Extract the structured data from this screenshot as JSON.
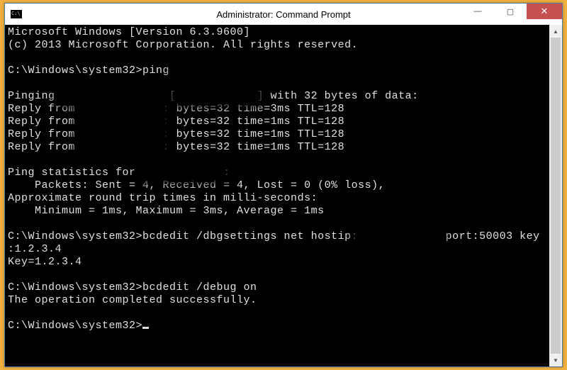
{
  "window": {
    "title": "Administrator: Command Prompt"
  },
  "controls": {
    "minimize": "—",
    "maximize": "▢",
    "close": "✕"
  },
  "terminal": {
    "lines": [
      {
        "t": "Microsoft Windows [Version 6.3.9600]"
      },
      {
        "t": "(c) 2013 Microsoft Corporation. All rights reserved."
      },
      {
        "t": ""
      },
      {
        "pre": "C:\\Windows\\system32>",
        "cmd": "ping ",
        "blur": "xxxxxxxx xx"
      },
      {
        "t": ""
      },
      {
        "pre": "Pinging ",
        "blur": "xxxxxxxx xxx xx",
        "mid": " [",
        "blur2": "xxx xx xx xx",
        "post": "] with 32 bytes of data:"
      },
      {
        "pre": "Reply from ",
        "blur": "xxx xx xx xx",
        "post": ": bytes=32 time=3ms TTL=128"
      },
      {
        "pre": "Reply from ",
        "blur": "xxx xx xx xx",
        "post": ": bytes=32 time=1ms TTL=128"
      },
      {
        "pre": "Reply from ",
        "blur": "xxx xx xx xx",
        "post": ": bytes=32 time=1ms TTL=128"
      },
      {
        "pre": "Reply from ",
        "blur": "xxx xx xx xx",
        "post": ": bytes=32 time=1ms TTL=128"
      },
      {
        "t": ""
      },
      {
        "pre": "Ping statistics for ",
        "blur": "xxx xx xx xx",
        "post": ":"
      },
      {
        "t": "    Packets: Sent = 4, Received = 4, Lost = 0 (0% loss),"
      },
      {
        "t": "Approximate round trip times in milli-seconds:"
      },
      {
        "t": "    Minimum = 1ms, Maximum = 3ms, Average = 1ms"
      },
      {
        "t": ""
      },
      {
        "pre": "C:\\Windows\\system32>",
        "cmd": "bcdedit /dbgsettings net hostip:",
        "blur": "xxx xx xx xx",
        "post": " port:50003 key"
      },
      {
        "t": ":1.2.3.4"
      },
      {
        "t": "Key=1.2.3.4"
      },
      {
        "t": ""
      },
      {
        "pre": "C:\\Windows\\system32>",
        "cmd": "bcdedit /debug on"
      },
      {
        "t": "The operation completed successfully."
      },
      {
        "t": ""
      },
      {
        "pre": "C:\\Windows\\system32>",
        "cursor": true
      }
    ]
  },
  "scrollbar": {
    "up": "▲",
    "down": "▼"
  }
}
